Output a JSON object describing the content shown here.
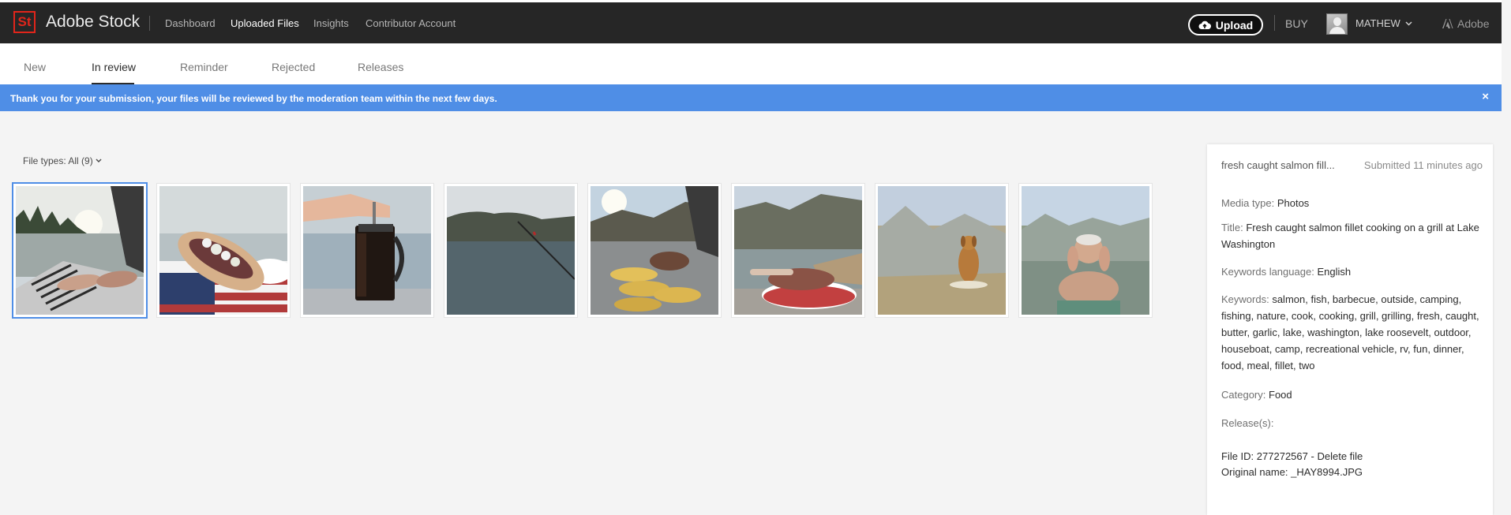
{
  "header": {
    "logo_text": "St",
    "brand": "Adobe Stock",
    "nav": [
      "Dashboard",
      "Uploaded Files",
      "Insights",
      "Contributor Account"
    ],
    "upload_label": "Upload",
    "buy_label": "BUY",
    "user_name": "MATHEW",
    "adobe_label": "Adobe"
  },
  "tabs": [
    "New",
    "In review",
    "Reminder",
    "Rejected",
    "Releases"
  ],
  "active_tab": "In review",
  "banner": {
    "text": "Thank you for your submission, your files will be reviewed by the moderation team within the next few days.",
    "close": "×"
  },
  "filter": {
    "label": "File types: All (9)"
  },
  "thumbnails": [
    "lake grill salmon",
    "hot dog flag",
    "french press",
    "lake fishing rod",
    "corn on grill",
    "steak on plate",
    "dog in lake",
    "man in lake"
  ],
  "details": {
    "short_title": "fresh caught salmon fill...",
    "submitted": "Submitted 11 minutes ago",
    "media_type_label": "Media type:",
    "media_type": "Photos",
    "title_label": "Title:",
    "title": "Fresh caught salmon fillet cooking on a grill at Lake Washington",
    "keywords_language_label": "Keywords language:",
    "keywords_language": "English",
    "keywords_label": "Keywords:",
    "keywords": "salmon, fish, barbecue, outside, camping, fishing, nature, cook, cooking, grill, grilling, fresh, caught, butter, garlic, lake, washington, lake roosevelt, outdoor, houseboat, camp, recreational vehicle, rv, fun, dinner, food, meal, fillet, two",
    "category_label": "Category:",
    "category": "Food",
    "releases_label": "Release(s):",
    "file_id_label": "File ID:",
    "file_id": "277272567",
    "delete_label": "Delete file",
    "original_name_label": "Original name:",
    "original_name": "_HAY8994.JPG"
  },
  "colors": {
    "accent": "#4f8ee6",
    "topbar": "#262626",
    "brand_red": "#e1251b"
  }
}
